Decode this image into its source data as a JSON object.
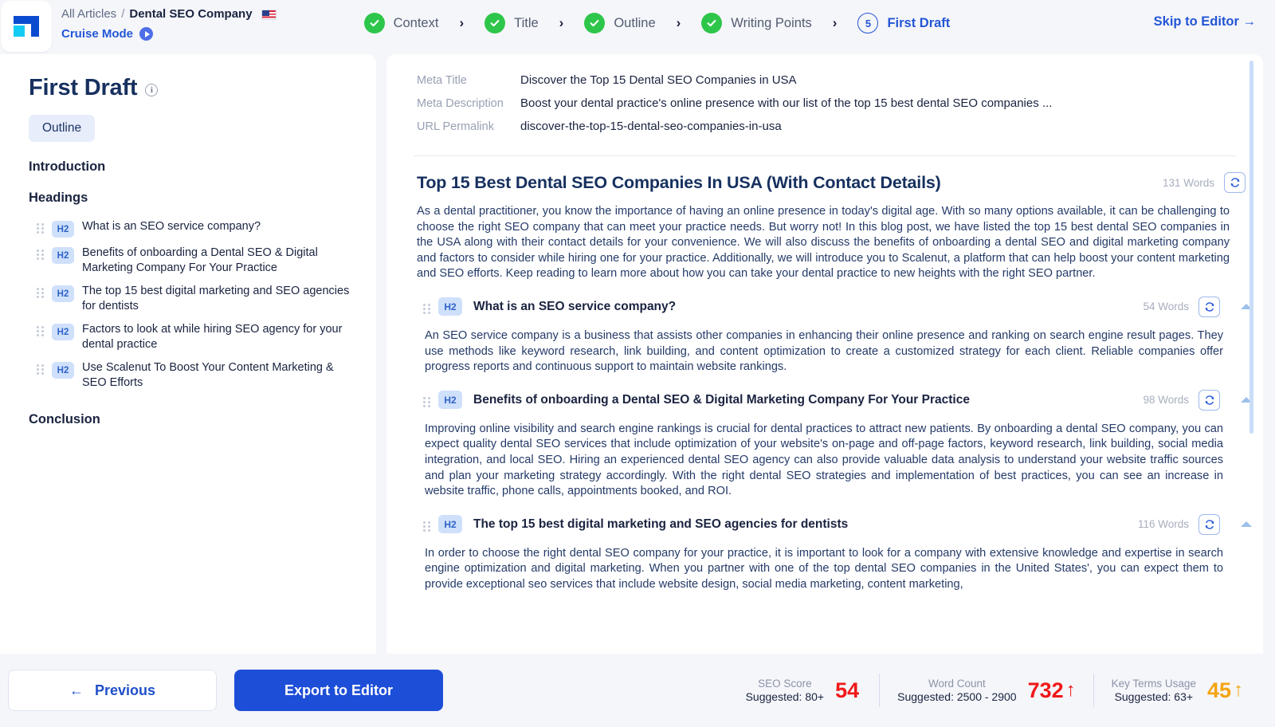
{
  "header": {
    "logo_name": "scalenut-logo",
    "breadcrumb": {
      "root": "All Articles",
      "separator": "/",
      "current": "Dental SEO Company",
      "locale_flag": "us-flag"
    },
    "cruise_mode": "Cruise Mode",
    "skip_to_editor": "Skip to Editor →",
    "steps": [
      {
        "label": "Context",
        "state": "complete",
        "marker": "✓"
      },
      {
        "label": "Title",
        "state": "complete",
        "marker": "✓"
      },
      {
        "label": "Outline",
        "state": "complete",
        "marker": "✓"
      },
      {
        "label": "Writing Points",
        "state": "complete",
        "marker": "✓"
      },
      {
        "label": "First Draft",
        "state": "active",
        "marker": "5"
      }
    ],
    "step_arrow": "›"
  },
  "sidebar": {
    "title": "First Draft",
    "info_glyph": "i",
    "tab": "Outline",
    "introduction_label": "Introduction",
    "headings_label": "Headings",
    "conclusion_label": "Conclusion",
    "headings": [
      {
        "level": "H2",
        "text": "What is an SEO service company?"
      },
      {
        "level": "H2",
        "text": "Benefits of onboarding a Dental SEO & Digital Marketing Company For Your Practice"
      },
      {
        "level": "H2",
        "text": "The top 15 best digital marketing and SEO agencies for dentists"
      },
      {
        "level": "H2",
        "text": "Factors to look at while hiring SEO agency for your dental practice"
      },
      {
        "level": "H2",
        "text": "Use Scalenut To Boost Your Content Marketing & SEO Efforts"
      }
    ]
  },
  "document": {
    "meta": [
      {
        "key": "Meta Title",
        "value": "Discover the Top 15 Dental SEO Companies in USA"
      },
      {
        "key": "Meta Description",
        "value": "Boost your dental practice's online presence with our list of the top 15 best dental SEO companies ..."
      },
      {
        "key": "URL Permalink",
        "value": "discover-the-top-15-dental-seo-companies-in-usa"
      }
    ],
    "title": "Top 15 Best Dental SEO Companies In USA (With Contact Details)",
    "title_words": "131 Words",
    "intro": "As a dental practitioner, you know the importance of having an online presence in today's digital age. With so many options available, it can be challenging to choose the right SEO company that can meet your practice needs. But worry not! In this blog post, we have listed the top 15 best dental SEO companies in the USA along with their contact details for your convenience. We will also discuss the benefits of onboarding a dental SEO and digital marketing company and factors to consider while hiring one for your practice. Additionally, we will introduce you to Scalenut, a platform that can help boost your content marketing and SEO efforts. Keep reading to learn more about how you can take your dental practice to new heights with the right SEO partner.",
    "sections": [
      {
        "level": "H2",
        "title": "What is an SEO service company?",
        "words": "54 Words",
        "body": "An SEO service company is a business that assists other companies in enhancing their online presence and ranking on search engine result pages. They use methods like keyword research, link building, and content optimization to create a customized strategy for each client. Reliable companies offer progress reports and continuous support to maintain website rankings."
      },
      {
        "level": "H2",
        "title": "Benefits of onboarding a Dental SEO & Digital Marketing Company For Your Practice",
        "words": "98 Words",
        "body": "Improving online visibility and search engine rankings is crucial for dental practices to attract new patients. By onboarding a dental SEO company, you can expect quality dental SEO services that include optimization of your website's on-page and off-page factors, keyword research, link building, social media integration, and local SEO. Hiring an experienced dental SEO agency can also provide valuable data analysis to understand your website traffic sources and plan your marketing strategy accordingly. With the right dental SEO strategies and implementation of best practices, you can see an increase in website traffic, phone calls, appointments booked, and ROI."
      },
      {
        "level": "H2",
        "title": "The top 15 best digital marketing and SEO agencies for dentists",
        "words": "116 Words",
        "body": "In order to choose the right dental SEO company for your practice, it is important to look for a company with extensive knowledge and expertise in search engine optimization and digital marketing. When you partner with one of the top dental SEO companies in the United States', you can expect them to provide exceptional seo services that include website design, social media marketing, content marketing,"
      }
    ]
  },
  "footer": {
    "previous": "Previous",
    "previous_arrow": "←",
    "export": "Export to Editor",
    "metrics": [
      {
        "title": "SEO Score",
        "suggested": "Suggested: 80+",
        "value": "54",
        "arrow": "",
        "color": "#f01818"
      },
      {
        "title": "Word Count",
        "suggested": "Suggested: 2500 - 2900",
        "value": "732",
        "arrow": "↑",
        "color": "#f01818"
      },
      {
        "title": "Key Terms Usage",
        "suggested": "Suggested: 63+",
        "value": "45",
        "arrow": "↑",
        "color": "#f5a411"
      }
    ]
  },
  "colors": {
    "brand_blue": "#1d4ed8",
    "accent_blue": "#2356d6",
    "success_green": "#2ec64a",
    "danger_red": "#f01818",
    "warning_amber": "#f5a411"
  }
}
